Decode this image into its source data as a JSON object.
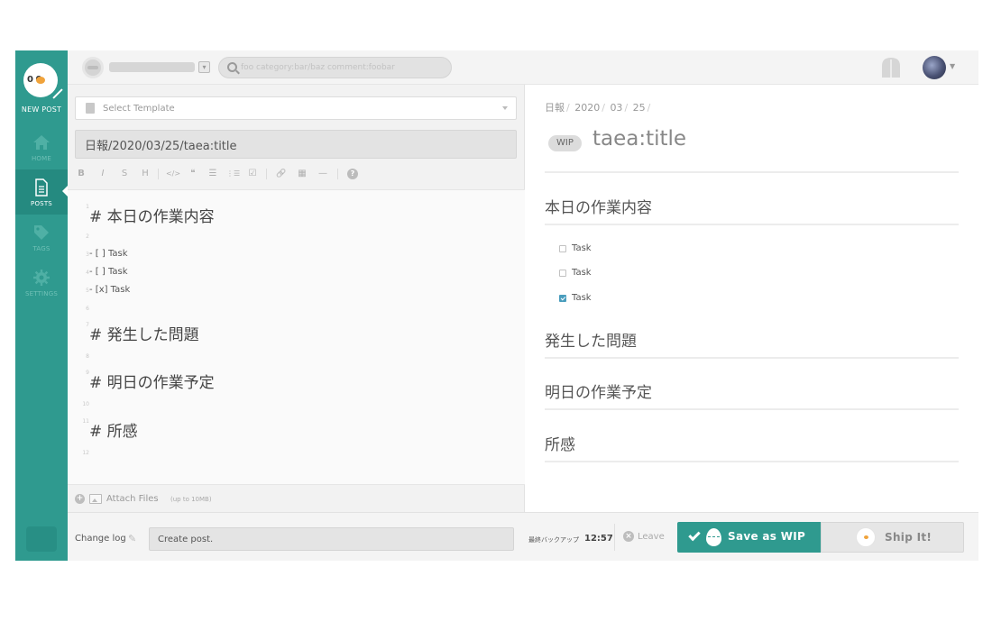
{
  "sidebar": {
    "logo_face": "0  0",
    "new_post": "NEW POST",
    "items": [
      {
        "label": "HOME"
      },
      {
        "label": "POSTS"
      },
      {
        "label": "TAGS"
      },
      {
        "label": "SETTINGS"
      }
    ],
    "active_item": "POSTS"
  },
  "topbar": {
    "search_placeholder": "foo category:bar/baz comment:foobar"
  },
  "editor": {
    "template_placeholder": "Select Template",
    "title_value": "日報/2020/03/25/taea:title",
    "toolbar": [
      "B",
      "I",
      "S",
      "H",
      "</>",
      "❝",
      "☰",
      "⋮☰",
      "☑",
      "🔗",
      "▦",
      "—",
      "?"
    ],
    "lines": [
      {
        "n": "1",
        "text": "# 本日の作業内容",
        "kind": "h"
      },
      {
        "n": "2",
        "text": "",
        "kind": "t"
      },
      {
        "n": "3",
        "text": "- [ ] Task",
        "kind": "t"
      },
      {
        "n": "4",
        "text": "- [ ] Task",
        "kind": "t"
      },
      {
        "n": "5",
        "text": "- [x] Task",
        "kind": "t"
      },
      {
        "n": "6",
        "text": "",
        "kind": "t"
      },
      {
        "n": "7",
        "text": "# 発生した問題",
        "kind": "h"
      },
      {
        "n": "8",
        "text": "",
        "kind": "t"
      },
      {
        "n": "9",
        "text": "# 明日の作業予定",
        "kind": "h"
      },
      {
        "n": "10",
        "text": "",
        "kind": "t"
      },
      {
        "n": "11",
        "text": "# 所感",
        "kind": "h"
      },
      {
        "n": "12",
        "text": "",
        "kind": "t"
      }
    ],
    "attach_label": "Attach Files",
    "attach_limit": "(up to 10MB)"
  },
  "preview": {
    "breadcrumbs": [
      "日報",
      "2020",
      "03",
      "25"
    ],
    "wip_badge": "WIP",
    "title": "taea:title",
    "sections": [
      {
        "heading": "本日の作業内容"
      },
      {
        "heading": "発生した問題"
      },
      {
        "heading": "明日の作業予定"
      },
      {
        "heading": "所感"
      }
    ],
    "tasks": [
      {
        "label": "Task",
        "checked": false
      },
      {
        "label": "Task",
        "checked": false
      },
      {
        "label": "Task",
        "checked": true
      }
    ]
  },
  "bottombar": {
    "changelog_label": "Change log",
    "changelog_value": "Create post.",
    "backup_label": "最終バックアップ",
    "backup_time": "12:57",
    "leave_label": "Leave",
    "save_wip_label": "Save as WIP",
    "ship_label": "Ship It!"
  },
  "colors": {
    "brand": "#2f9a8f",
    "checkbox_checked": "#4a9dbd"
  }
}
